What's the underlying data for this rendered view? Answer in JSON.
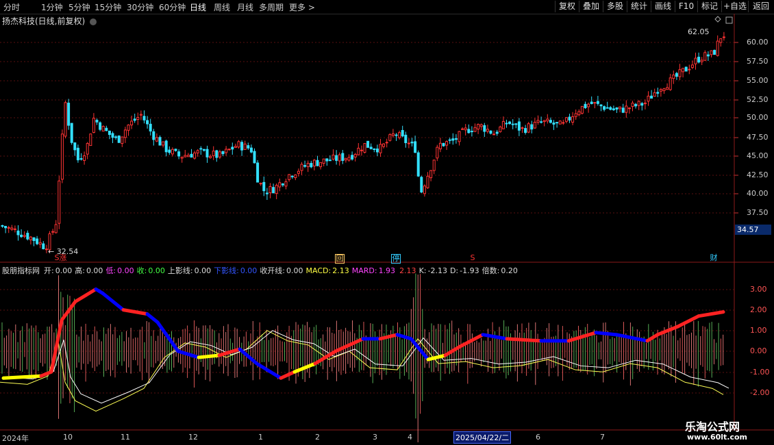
{
  "toolbar": {
    "periods": [
      "分时",
      "1分钟",
      "5分钟",
      "15分钟",
      "30分钟",
      "60分钟",
      "日线",
      "周线",
      "月线",
      "多周期",
      "更多 >"
    ],
    "active_period": "日线",
    "right_buttons": [
      "复权",
      "叠加",
      "多股",
      "统计",
      "画线",
      "F10",
      "标记",
      "+自选",
      "返回"
    ]
  },
  "main": {
    "title": "扬杰科技(日线,前复权)",
    "high_label": "62.05",
    "low_label": "32.54",
    "current_price": "34.57",
    "price_ticks": [
      "60.00",
      "57.50",
      "55.00",
      "52.50",
      "50.00",
      "47.50",
      "45.00",
      "42.50",
      "40.00",
      "37.50"
    ],
    "markers": [
      {
        "text": "S",
        "color": "#ff3333"
      },
      {
        "text": "涨",
        "color": "#ff3333"
      },
      {
        "text": "回",
        "color": "#ffcc66"
      },
      {
        "text": "停",
        "color": "#33ccff"
      },
      {
        "text": "S",
        "color": "#ff3333"
      },
      {
        "text": "财",
        "color": "#33ccff"
      }
    ]
  },
  "indicator": {
    "name": "股朋指标网",
    "items": [
      {
        "label": "开:",
        "value": "0.00",
        "color": "#dddddd"
      },
      {
        "label": "高:",
        "value": "0.00",
        "color": "#dddddd"
      },
      {
        "label": "低:",
        "value": "0.00",
        "color": "#ff44ff"
      },
      {
        "label": "收:",
        "value": "0.00",
        "color": "#44ff44"
      },
      {
        "label": "上影线:",
        "value": "0.00",
        "color": "#dddddd"
      },
      {
        "label": "下影线:",
        "value": "0.00",
        "color": "#3355ff"
      },
      {
        "label": "收开线:",
        "value": "0.00",
        "color": "#dddddd"
      },
      {
        "label": "MACD:",
        "value": "2.13",
        "color": "#ffff44"
      },
      {
        "label": "MARD:",
        "value": "1.93",
        "color": "#ff44ff"
      },
      {
        "label": "",
        "value": "2.13",
        "color": "#ff4444"
      },
      {
        "label": "K:",
        "value": "-2.13",
        "color": "#dddddd"
      },
      {
        "label": "D:",
        "value": "-1.93",
        "color": "#dddddd"
      },
      {
        "label": "倍数:",
        "value": "0.20",
        "color": "#dddddd"
      }
    ],
    "ticks": [
      "3.00",
      "2.00",
      "1.00",
      "0.00",
      "-1.00",
      "-2.00"
    ]
  },
  "dates": {
    "labels": [
      "2024年",
      "10",
      "11",
      "12",
      "1",
      "2",
      "3",
      "4",
      "6",
      "7"
    ],
    "highlight": "2025/04/22/二"
  },
  "watermark": {
    "line1": "乐淘公式网",
    "line2": "www.60lt.com"
  }
}
